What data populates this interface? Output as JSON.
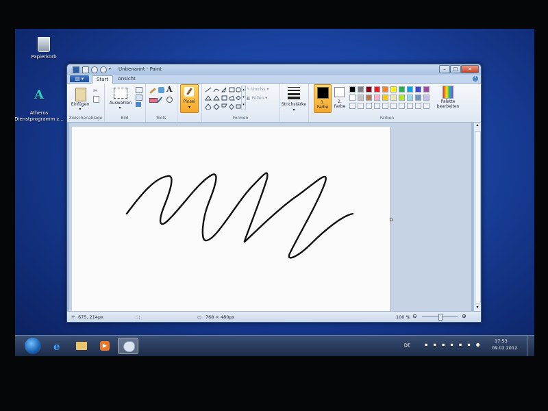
{
  "desktop": {
    "icons": [
      {
        "label": "Papierkorb",
        "icon": "recycle-bin-icon"
      },
      {
        "label": "Atheros\nDienstprogramm z...",
        "icon": "atheros-icon"
      }
    ]
  },
  "window": {
    "title": "Unbenannt - Paint",
    "controls": {
      "minimize": "–",
      "maximize": "□",
      "close": "✕"
    }
  },
  "ribbon": {
    "file_menu_icon": "paint-menu-icon",
    "tabs": [
      "Start",
      "Ansicht"
    ],
    "active_tab": "Start",
    "groups": {
      "clipboard": {
        "label": "Zwischenablage",
        "paste": "Einfügen"
      },
      "image": {
        "label": "Bild",
        "select": "Auswählen"
      },
      "tools": {
        "label": "Tools"
      },
      "brush": {
        "label": "Pinsel"
      },
      "shapes": {
        "label": "Formen",
        "outline": "Umriss",
        "fill": "Füllen"
      },
      "size": {
        "label": "Strichstärke"
      },
      "colors": {
        "label": "Farben",
        "color1": "1.\nFarbe",
        "color2": "2.\nFarbe",
        "edit": "Palette\nbearbeiten",
        "color1_value": "#000000",
        "color2_value": "#ffffff",
        "palette": [
          "#000000",
          "#7f7f7f",
          "#880015",
          "#ed1c24",
          "#ff7f27",
          "#fff200",
          "#22b14c",
          "#00a2e8",
          "#3f48cc",
          "#a349a4",
          "#ffffff",
          "#c3c3c3",
          "#b97a57",
          "#ffaec9",
          "#ffc90e",
          "#efe4b0",
          "#b5e61d",
          "#99d9ea",
          "#7092be",
          "#c8bfe7"
        ]
      }
    }
  },
  "status": {
    "cursor_pos": "675, 214px",
    "canvas_size": "768 × 480px",
    "zoom": "100 %"
  },
  "taskbar": {
    "apps": [
      "windows-explorer-icon",
      "internet-explorer-icon",
      "folder-icon",
      "media-player-icon",
      "paint-icon"
    ],
    "language": "DE",
    "time": "17:53",
    "date": "09.02.2012"
  }
}
